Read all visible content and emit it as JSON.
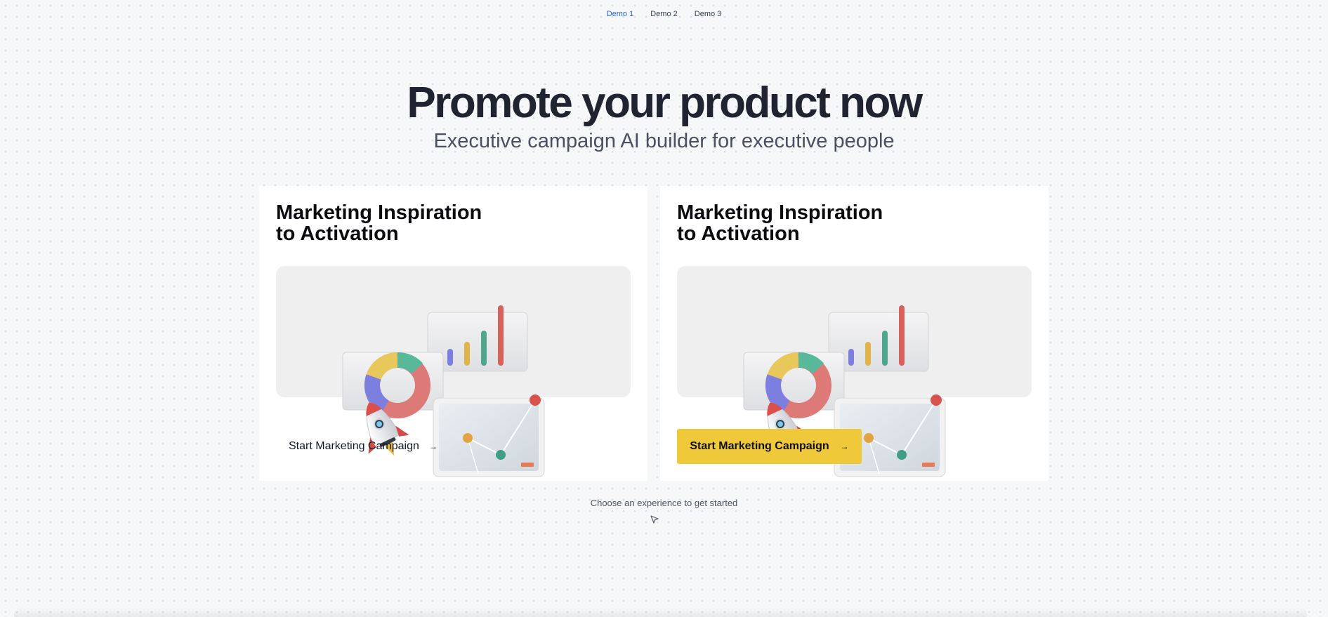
{
  "nav": {
    "items": [
      {
        "label": "Demo 1",
        "active": true
      },
      {
        "label": "Demo 2",
        "active": false
      },
      {
        "label": "Demo 3",
        "active": false
      }
    ]
  },
  "hero": {
    "title": "Promote your product now",
    "subtitle": "Executive campaign AI builder for executive people"
  },
  "cards": [
    {
      "title_line1": "Marketing Inspiration",
      "title_line2": "to Activation",
      "cta_label": "Start Marketing Campaign",
      "cta_style": "plain"
    },
    {
      "title_line1": "Marketing Inspiration",
      "title_line2": "to Activation",
      "cta_label": "Start Marketing Campaign",
      "cta_style": "primary"
    }
  ],
  "hint": "Choose an experience to get started",
  "icons": {
    "cta_arrow": "arrow-right-icon",
    "cursor": "cursor-pointer-icon",
    "illustration": "marketing-analytics-illustration"
  },
  "colors": {
    "accent": "#2563eb",
    "primary_button": "#efc93a",
    "page_bg": "#f6f7f9",
    "card_bg": "#ffffff"
  }
}
